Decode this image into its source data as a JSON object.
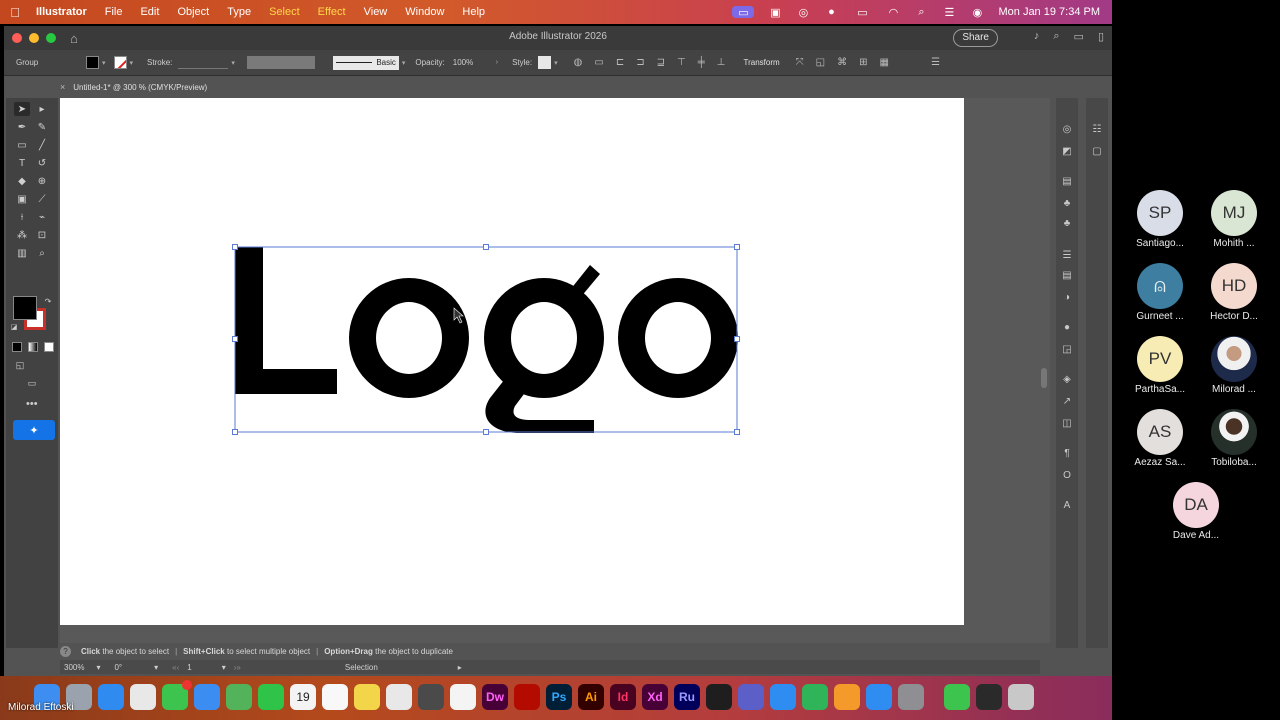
{
  "menubar": {
    "app_name": "Illustrator",
    "items": [
      "File",
      "Edit",
      "Object",
      "Type",
      "Select",
      "Effect",
      "View",
      "Window",
      "Help"
    ],
    "datetime": "Mon Jan 19  7:34 PM"
  },
  "window": {
    "title": "Adobe Illustrator 2026",
    "share_label": "Share"
  },
  "controlbar": {
    "selection_type": "Group",
    "stroke_label": "Stroke:",
    "brush_label": "Basic",
    "opacity_label": "Opacity:",
    "opacity_value": "100%",
    "style_label": "Style:",
    "transform_label": "Transform"
  },
  "document_tab": {
    "close": "×",
    "title": "Untitled-1* @ 300 % (CMYK/Preview)"
  },
  "canvas": {
    "logo_text": "Logo"
  },
  "statusbar": {
    "hint1_bold": "Click",
    "hint1_rest": "the object to select",
    "hint2_bold": "Shift+Click",
    "hint2_rest": "to select multiple object",
    "hint3_bold": "Option+Drag",
    "hint3_rest": "the object to duplicate",
    "zoom": "300%",
    "rotation": "0°",
    "artboard_number": "1",
    "tool_name": "Selection"
  },
  "participants": [
    {
      "initials": "SP",
      "name": "Santiago...",
      "color": "#d9dde8"
    },
    {
      "initials": "MJ",
      "name": "Mohith ...",
      "color": "#d9e6d3"
    },
    {
      "initials": "",
      "name": "Gurneet ...",
      "color": "#3e7ea0",
      "icon": "person-icon"
    },
    {
      "initials": "HD",
      "name": "Hector D...",
      "color": "#f4d9cf"
    },
    {
      "initials": "PV",
      "name": "ParthaSa...",
      "color": "#f6ecb4"
    },
    {
      "initials": "",
      "name": "Milorad ...",
      "color": "#e8e8e8",
      "icon": "photo-avatar"
    },
    {
      "initials": "AS",
      "name": "Aezaz Sa...",
      "color": "#e3dfdc"
    },
    {
      "initials": "",
      "name": "Tobiloba...",
      "color": "#5a6a5c",
      "icon": "photo-avatar"
    },
    {
      "initials": "DA",
      "name": "Dave Ad...",
      "color": "#f5d6de"
    }
  ],
  "dock": {
    "presenter_name": "Milorad Eftoski",
    "apps": [
      {
        "name": "finder-icon",
        "label": "",
        "color": "#3d8ef0"
      },
      {
        "name": "launchpad-icon",
        "label": "",
        "color": "#9aa3ad"
      },
      {
        "name": "safari-icon",
        "label": "",
        "color": "#2f8bf0"
      },
      {
        "name": "chrome-icon",
        "label": "",
        "color": "#e8e8e8"
      },
      {
        "name": "messages-icon",
        "label": "",
        "color": "#3cc44e"
      },
      {
        "name": "mail-icon",
        "label": "",
        "color": "#3b8df2"
      },
      {
        "name": "maps-icon",
        "label": "",
        "color": "#52b35a"
      },
      {
        "name": "facetime-icon",
        "label": "",
        "color": "#2fc34a"
      },
      {
        "name": "calendar-icon",
        "label": "19",
        "color": "#f4f4f4"
      },
      {
        "name": "reminders-icon",
        "label": "",
        "color": "#f8f8f8"
      },
      {
        "name": "notes-icon",
        "label": "",
        "color": "#f3d54a"
      },
      {
        "name": "files-icon",
        "label": "",
        "color": "#e8e8e8"
      },
      {
        "name": "calculator-icon",
        "label": "",
        "color": "#4a4a4a"
      },
      {
        "name": "freeform-icon",
        "label": "",
        "color": "#f4f4f4"
      },
      {
        "name": "dreamweaver-icon",
        "label": "Dw",
        "color": "#470137"
      },
      {
        "name": "acrobat-icon",
        "label": "",
        "color": "#b30b00"
      },
      {
        "name": "photoshop-icon",
        "label": "Ps",
        "color": "#001e36"
      },
      {
        "name": "illustrator-icon",
        "label": "Ai",
        "color": "#330000"
      },
      {
        "name": "indesign-icon",
        "label": "Id",
        "color": "#49021f"
      },
      {
        "name": "xd-icon",
        "label": "Xd",
        "color": "#470137"
      },
      {
        "name": "rush-icon",
        "label": "Ru",
        "color": "#00005b"
      },
      {
        "name": "figma-icon",
        "label": "",
        "color": "#1e1e1e"
      },
      {
        "name": "teams-icon",
        "label": "",
        "color": "#5b5fc7"
      },
      {
        "name": "keynote-icon",
        "label": "",
        "color": "#2f8cf0"
      },
      {
        "name": "numbers-icon",
        "label": "",
        "color": "#2fb45a"
      },
      {
        "name": "pages-icon",
        "label": "",
        "color": "#f39a2b"
      },
      {
        "name": "appstore-icon",
        "label": "",
        "color": "#2f8cf0"
      },
      {
        "name": "settings-icon",
        "label": "",
        "color": "#8e8e93"
      },
      {
        "name": "phone-icon",
        "label": "",
        "color": "#3cc44e"
      },
      {
        "name": "screen-sharing-icon",
        "label": "",
        "color": "#2a2a2a"
      },
      {
        "name": "trash-icon",
        "label": "",
        "color": "#c8c8c8"
      }
    ]
  }
}
